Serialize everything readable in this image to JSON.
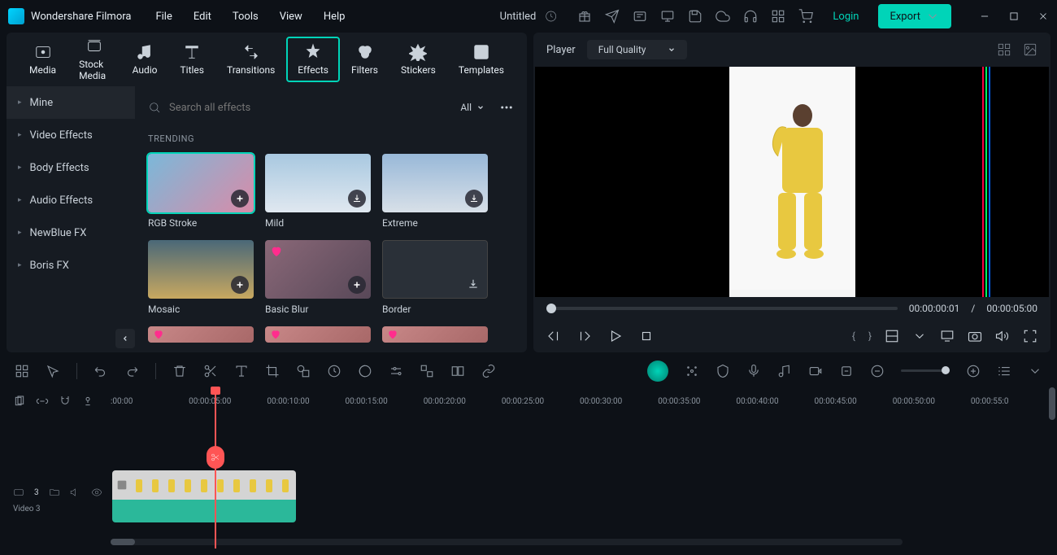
{
  "app": "Wondershare Filmora",
  "menu": [
    "File",
    "Edit",
    "Tools",
    "View",
    "Help"
  ],
  "docTitle": "Untitled",
  "login": "Login",
  "export": "Export",
  "tabs": [
    "Media",
    "Stock Media",
    "Audio",
    "Titles",
    "Transitions",
    "Effects",
    "Filters",
    "Stickers",
    "Templates"
  ],
  "activeTab": "Effects",
  "sidebar": [
    "Mine",
    "Video Effects",
    "Body Effects",
    "Audio Effects",
    "NewBlue FX",
    "Boris FX"
  ],
  "searchPlaceholder": "Search all effects",
  "filterLabel": "All",
  "sectionLabel": "TRENDING",
  "effects": [
    {
      "label": "RGB Stroke",
      "badge": "add",
      "selected": true
    },
    {
      "label": "Mild",
      "badge": "download"
    },
    {
      "label": "Extreme",
      "badge": "download"
    },
    {
      "label": "Mosaic",
      "badge": "add"
    },
    {
      "label": "Basic Blur",
      "badge": "add",
      "heart": true
    },
    {
      "label": "Border",
      "badge": "download",
      "empty": true
    }
  ],
  "player": {
    "label": "Player",
    "quality": "Full Quality",
    "current": "00:00:00:01",
    "sep": "/",
    "total": "00:00:05:00"
  },
  "ruler": [
    ":00:00",
    "00:00:05:00",
    "00:00:10:00",
    "00:00:15:00",
    "00:00:20:00",
    "00:00:25:00",
    "00:00:30:00",
    "00:00:35:00",
    "00:00:40:00",
    "00:00:45:00",
    "00:00:50:00",
    "00:00:55:0"
  ],
  "track": {
    "name": "Video 3",
    "index": "3"
  }
}
